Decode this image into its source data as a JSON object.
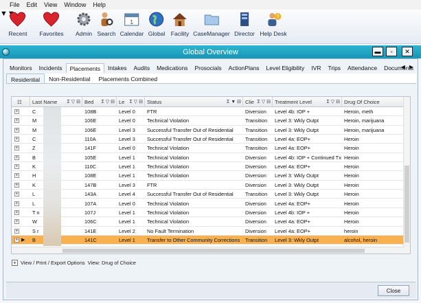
{
  "menu": [
    "File",
    "Edit",
    "View",
    "Window",
    "Help"
  ],
  "toolbar": [
    {
      "label": "Recent",
      "icon": "heart-icon"
    },
    {
      "label": "Favorites",
      "icon": "heart-icon"
    },
    {
      "label": "Admin",
      "icon": "gear-icon"
    },
    {
      "label": "Search",
      "icon": "person-search-icon"
    },
    {
      "label": "Calendar",
      "icon": "calendar-icon"
    },
    {
      "label": "Global",
      "icon": "globe-icon"
    },
    {
      "label": "Facility",
      "icon": "house-icon"
    },
    {
      "label": "CaseManager",
      "icon": "folder-icon"
    },
    {
      "label": "Director",
      "icon": "director-icon"
    },
    {
      "label": "Help Desk",
      "icon": "help-desk-icon"
    }
  ],
  "window": {
    "title": "Global Overview",
    "buttons": [
      "▬",
      "▫",
      "✕"
    ]
  },
  "tabs": [
    "Monitors",
    "Incidents",
    "Placements",
    "Intakes",
    "Audits",
    "Medications",
    "Prosocials",
    "ActionPlans",
    "Level Eligibility",
    "IVR",
    "Trips",
    "Attendance",
    "Documents"
  ],
  "active_tab": "Placements",
  "tabs_nav": [
    "◀",
    "▶"
  ],
  "subtabs": [
    "Residential",
    "Non-Residential",
    "Placements Combined"
  ],
  "active_subtab": "Residential",
  "grid": {
    "columns": [
      "Last Name",
      "Bed",
      "Le",
      "Status",
      "Clie",
      "Treatment Level",
      "Drug Of Choice"
    ],
    "column_filters": [
      "Σ ▽ ⊟",
      "Σ ▽ ⊟",
      "Σ ▽ ⊟",
      "Σ ▼ ⊟",
      "Σ ▽ ⊟",
      "Σ ▽ ⊟",
      ""
    ],
    "rows": [
      {
        "name": "C",
        "bed": "108B",
        "level": "Level 0",
        "status": "FTR",
        "client": "Diversion",
        "treatment": "Level 4b: IOP +",
        "drug": "Heroin, meth"
      },
      {
        "name": "M",
        "bed": "106E",
        "level": "Level 0",
        "status": "Technical Violation",
        "client": "Transition",
        "treatment": "Level 3: Wkly Outpt",
        "drug": "Heroin, marijuana"
      },
      {
        "name": "M",
        "bed": "106E",
        "level": "Level 3",
        "status": "Successful Transfer Out of Residential",
        "client": "Transition",
        "treatment": "Level 3: Wkly Outpt",
        "drug": "Heroin, marijuana"
      },
      {
        "name": "C",
        "bed": "110A",
        "level": "Level 3",
        "status": "Successful Transfer Out of Residential",
        "client": "Transition",
        "treatment": "Level 4a: EOP+",
        "drug": "Heroin"
      },
      {
        "name": "Z",
        "bed": "141F",
        "level": "Level 0",
        "status": "Technical Violation",
        "client": "Transition",
        "treatment": "Level 4a: EOP+",
        "drug": "Heroin"
      },
      {
        "name": "B",
        "bed": "105E",
        "level": "Level 1",
        "status": "Technical Violation",
        "client": "Diversion",
        "treatment": "Level 4b: IOP + Continued Tx",
        "drug": "Heroin"
      },
      {
        "name": "K",
        "bed": "110C",
        "level": "Level 1",
        "status": "Technical Violation",
        "client": "Diversion",
        "treatment": "Level 4a: EOP+",
        "drug": "Heroin"
      },
      {
        "name": "H",
        "bed": "108E",
        "level": "Level 1",
        "status": "Technical Violation",
        "client": "Diversion",
        "treatment": "Level 3: Wkly Outpt",
        "drug": "Heroin"
      },
      {
        "name": "K",
        "bed": "147B",
        "level": "Level 3",
        "status": "FTR",
        "client": "Diversion",
        "treatment": "Level 3: Wkly Outpt",
        "drug": "Heroin"
      },
      {
        "name": "L",
        "bed": "143A",
        "level": "Level 4",
        "status": "Successful Transfer Out of Residential",
        "client": "Transition",
        "treatment": "Level 3: Wkly Outpt",
        "drug": "Heroin"
      },
      {
        "name": "L",
        "bed": "107A",
        "level": "Level 0",
        "status": "Technical Violation",
        "client": "Diversion",
        "treatment": "Level 4a: EOP+",
        "drug": "Heroin"
      },
      {
        "name": "T    n",
        "bed": "107J",
        "level": "Level 1",
        "status": "Technical Violation",
        "client": "Diversion",
        "treatment": "Level 4b: IOP +",
        "drug": "Heroin"
      },
      {
        "name": "W",
        "bed": "106C",
        "level": "Level 1",
        "status": "Technical Violation",
        "client": "Diversion",
        "treatment": "Level 4a: EOP+",
        "drug": "Heroin"
      },
      {
        "name": "S    r",
        "bed": "141E",
        "level": "Level 2",
        "status": "No Fault Termination",
        "client": "Diversion",
        "treatment": "Level 4a: EOP+",
        "drug": "heroin"
      },
      {
        "name": "B",
        "bed": "141C",
        "level": "Level 1",
        "status": "Transfer to Other Community Corrections",
        "client": "Transition",
        "treatment": "Level 3: Wkly Outpt",
        "drug": "alcohol, heroin",
        "selected": true
      }
    ]
  },
  "footer": {
    "export": "View / Print / Export Options",
    "drug": "View: Drug of Choice"
  },
  "close_button": "Close",
  "colors": {
    "titlebar": "#1ea4c4",
    "selected_row": "#f9b04e",
    "heart": "#d9232d"
  }
}
